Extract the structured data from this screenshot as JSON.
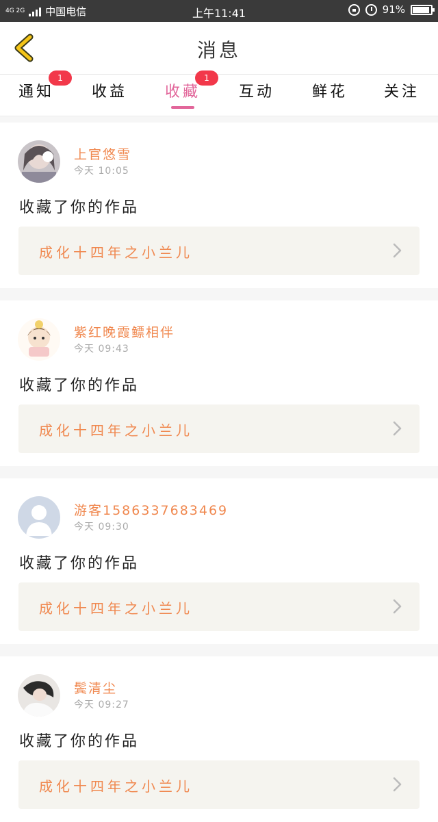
{
  "status_bar": {
    "network": "4G 2G",
    "carrier": "中国电信",
    "time": "上午11:41",
    "battery": "91%",
    "battery_level": 0.91
  },
  "header": {
    "title": "消息",
    "back_icon": "chevron-left-icon"
  },
  "tabs": [
    {
      "label": "通知",
      "badge": "1",
      "active": false
    },
    {
      "label": "收益",
      "badge": "",
      "active": false
    },
    {
      "label": "收藏",
      "badge": "1",
      "active": true
    },
    {
      "label": "互动",
      "badge": "",
      "active": false
    },
    {
      "label": "鲜花",
      "badge": "",
      "active": false
    },
    {
      "label": "关注",
      "badge": "",
      "active": false
    }
  ],
  "messages": [
    {
      "user": "上官悠雪",
      "time": "今天 10:05",
      "action": "收藏了你的作品",
      "work": "成化十四年之小兰儿",
      "avatar": "girl-photo-avatar"
    },
    {
      "user": "紫红晚霞鳔相伴",
      "time": "今天 09:43",
      "action": "收藏了你的作品",
      "work": "成化十四年之小兰儿",
      "avatar": "cartoon-girl-avatar"
    },
    {
      "user": "游客15863376834​69",
      "time": "今天 09:30",
      "action": "收藏了你的作品",
      "work": "成化十四年之小兰儿",
      "avatar": "default-user-avatar"
    },
    {
      "user": "鬓清尘",
      "time": "今天 09:27",
      "action": "收藏了你的作品",
      "work": "成化十四年之小兰儿",
      "avatar": "girl-photo-avatar-2"
    }
  ],
  "colors": {
    "accent": "#e2669a",
    "username": "#f0884f",
    "badge": "#f2384a",
    "back_icon": "#f5c518"
  }
}
